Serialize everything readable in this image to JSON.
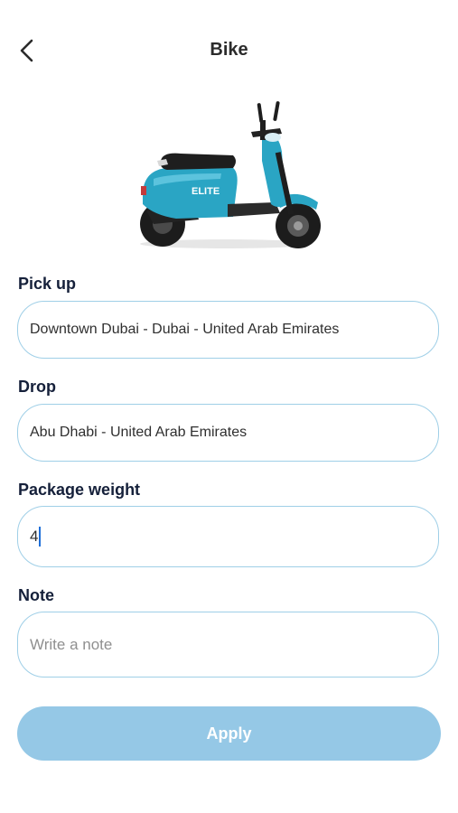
{
  "header": {
    "title": "Bike"
  },
  "hero": {
    "brand_text": "ELITE"
  },
  "form": {
    "pickup_label": "Pick up",
    "pickup_value": "Downtown Dubai - Dubai - United Arab Emirates",
    "drop_label": "Drop",
    "drop_value": "Abu Dhabi - United Arab Emirates",
    "weight_label": "Package weight",
    "weight_value": "4",
    "note_label": "Note",
    "note_placeholder": "Write a note"
  },
  "actions": {
    "apply_label": "Apply"
  },
  "colors": {
    "field_border": "#9fcfe7",
    "button_bg": "#95c8e6",
    "scooter_body": "#2aa5c4"
  }
}
